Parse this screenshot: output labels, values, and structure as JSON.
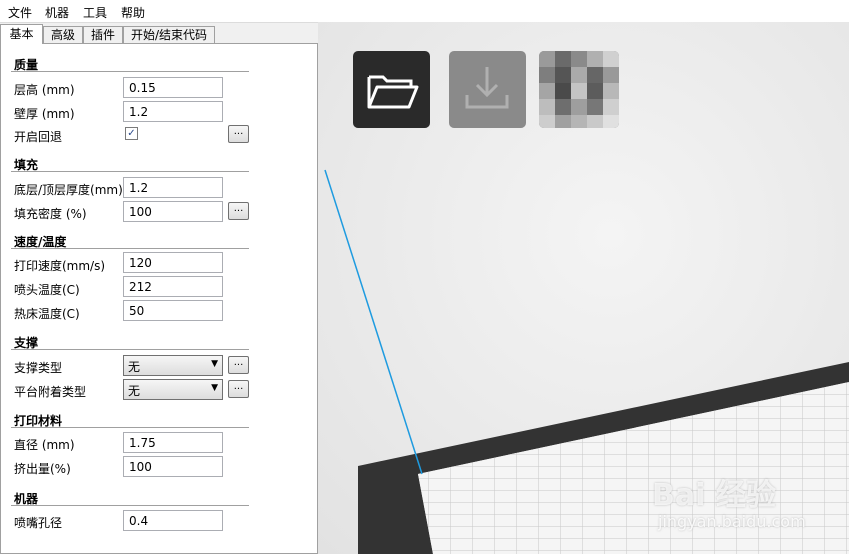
{
  "menu": [
    "文件",
    "机器",
    "工具",
    "帮助"
  ],
  "tabs": [
    "基本",
    "高级",
    "插件",
    "开始/结束代码"
  ],
  "sections": {
    "quality": {
      "title": "质量",
      "layer_height_label": "层高 (mm)",
      "layer_height": "0.15",
      "shell_label": "壁厚 (mm)",
      "shell": "1.2",
      "retraction_label": "开启回退",
      "retraction_checked": "✓"
    },
    "fill": {
      "title": "填充",
      "bottom_top_label": "底层/顶层厚度(mm)",
      "bottom_top": "1.2",
      "density_label": "填充密度 (%)",
      "density": "100"
    },
    "speed": {
      "title": "速度/温度",
      "print_speed_label": "打印速度(mm/s)",
      "print_speed": "120",
      "nozzle_temp_label": "喷头温度(C)",
      "nozzle_temp": "212",
      "bed_temp_label": "热床温度(C)",
      "bed_temp": "50"
    },
    "support": {
      "title": "支撑",
      "support_type_label": "支撑类型",
      "support_type": "无",
      "adhesion_label": "平台附着类型",
      "adhesion": "无"
    },
    "filament": {
      "title": "打印材料",
      "diameter_label": "直径 (mm)",
      "diameter": "1.75",
      "flow_label": "挤出量(%)",
      "flow": "100"
    },
    "machine": {
      "title": "机器",
      "nozzle_size_label": "喷嘴孔径",
      "nozzle_size": "0.4"
    }
  },
  "dots_label": "...",
  "watermark": {
    "text": "Bai 经验",
    "url": "jingyan.baidu.com"
  },
  "colors": {
    "accent_line": "#1e9be0",
    "platform_dark": "#333333",
    "tool_button": "#2a2a2a"
  }
}
